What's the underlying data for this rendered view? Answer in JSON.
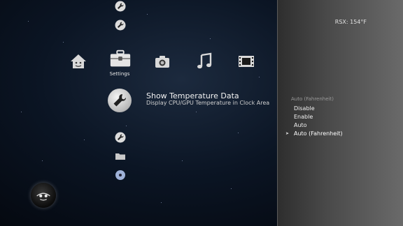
{
  "xmb": {
    "categories": [
      {
        "name": "home-icon"
      },
      {
        "name": "toolbox-icon",
        "label": "Settings",
        "selected": true
      },
      {
        "name": "camera-icon"
      },
      {
        "name": "music-note-icon"
      },
      {
        "name": "film-strip-icon"
      },
      {
        "name": "gamepad-icon"
      },
      {
        "name": "robot-icon"
      },
      {
        "name": "space-invader-icon"
      }
    ],
    "settings_label": "Settings"
  },
  "selected_item": {
    "title": "Show Temperature Data",
    "description": "Display CPU/GPU Temperature in Clock Area",
    "icon": "wrench-icon"
  },
  "side_panel": {
    "temperature": "RSX: 154°F",
    "current_value": "Auto (Fahrenheit)",
    "options": [
      {
        "label": "Disable",
        "selected": false
      },
      {
        "label": "Enable",
        "selected": false
      },
      {
        "label": "Auto",
        "selected": false
      },
      {
        "label": "Auto (Fahrenheit)",
        "selected": true
      }
    ]
  },
  "colors": {
    "background": "#0b1524",
    "panel": "#4a4a4a",
    "text": "#f0f0f0"
  }
}
